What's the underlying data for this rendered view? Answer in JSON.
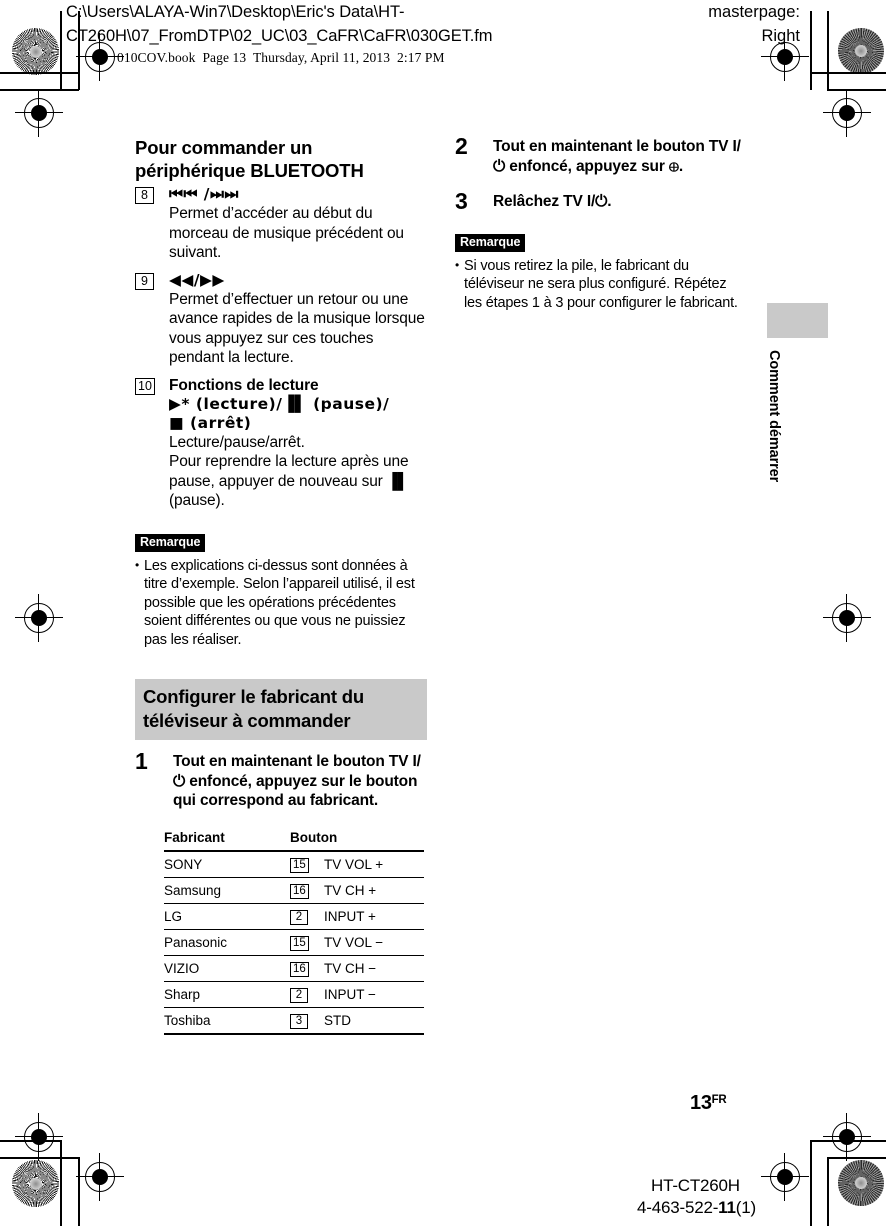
{
  "header": {
    "path_line1": "C:\\Users\\ALAYA-Win7\\Desktop\\Eric's Data\\HT-",
    "path_line2": "CT260H\\07_FromDTP\\02_UC\\03_CaFR\\CaFR\\030GET.fm",
    "masterpage_label": "masterpage:",
    "masterpage_value": "Right",
    "book_info": "010COV.book  Page 13  Thursday, April 11, 2013  2:17 PM"
  },
  "left_column": {
    "section_title_line1": "Pour commander un",
    "section_title_line2": "périphérique BLUETOOTH",
    "items": [
      {
        "number": "8",
        "head": "⏮⏮ /⏭⏭",
        "body": "Permet d’accéder au début du morceau de musique précédent ou suivant."
      },
      {
        "number": "9",
        "head": "◀◀/▶▶",
        "body": "Permet d’effectuer un retour ou une avance rapides de la musique lorsque vous appuyez sur ces touches pendant la lecture."
      },
      {
        "number": "10",
        "head_line1": "Fonctions de lecture",
        "head_line2": "▶* (lecture)/▐▌ (pause)/",
        "head_line3": "■ (arrêt)",
        "body_line1": "Lecture/pause/arrêt.",
        "body_line2": "Pour reprendre la lecture après une pause, appuyer de nouveau sur ▐▌  (pause)."
      }
    ],
    "note_badge": "Remarque",
    "note_text": "Les explications ci-dessus sont données à titre d’exemple. Selon l’appareil utilisé, il est possible que les opérations précédentes soient différentes ou que vous ne puissiez pas les réaliser.",
    "gray_heading_line1": "Configurer le fabricant du",
    "gray_heading_line2": "téléviseur à commander",
    "step1_number": "1",
    "step1_text": "Tout en maintenant le bouton TV I/⏻ enfoncé, appuyez sur le bouton qui correspond au fabricant.",
    "table": {
      "headers": [
        "Fabricant",
        "Bouton"
      ],
      "rows": [
        {
          "fabricant": "SONY",
          "num": "15",
          "bouton": "TV VOL +"
        },
        {
          "fabricant": "Samsung",
          "num": "16",
          "bouton": "TV CH +"
        },
        {
          "fabricant": "LG",
          "num": "2",
          "bouton": "INPUT +"
        },
        {
          "fabricant": "Panasonic",
          "num": "15",
          "bouton": "TV VOL −"
        },
        {
          "fabricant": "VIZIO",
          "num": "16",
          "bouton": "TV CH −"
        },
        {
          "fabricant": "Sharp",
          "num": "2",
          "bouton": "INPUT −"
        },
        {
          "fabricant": "Toshiba",
          "num": "3",
          "bouton": "STD"
        }
      ]
    }
  },
  "right_column": {
    "step2_number": "2",
    "step2_text": "Tout en maintenant le bouton TV I/⏻ enfoncé, appuyez sur ⊕.",
    "step3_number": "3",
    "step3_text": "Relâchez TV I/⏻.",
    "note_badge": "Remarque",
    "note_text": "Si vous retirez la pile, le fabricant du téléviseur ne sera plus configuré. Répétez les étapes 1 à 3 pour configurer le fabricant."
  },
  "thumb_tab_label": "Comment démarrer",
  "footer": {
    "page_number": "13",
    "page_suffix": "FR",
    "model": "HT-CT260H",
    "code_prefix": "4-463-522-",
    "code_bold": "11",
    "code_suffix": "(1)"
  },
  "colors": {
    "gray_bar": "#c9c9c9",
    "note_badge_bg": "#000000",
    "text": "#000000"
  }
}
